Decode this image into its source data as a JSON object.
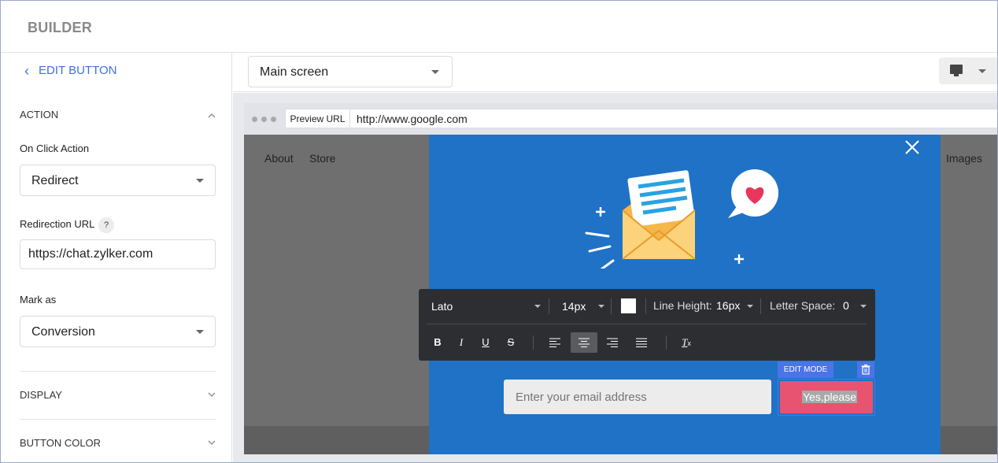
{
  "header": {
    "title": "BUILDER"
  },
  "sidebar": {
    "back_label": "EDIT BUTTON",
    "action_section": "ACTION",
    "on_click_label": "On Click Action",
    "on_click_value": "Redirect",
    "redirection_label": "Redirection URL",
    "help_glyph": "?",
    "redirection_value": "https://chat.zylker.com",
    "mark_as_label": "Mark as",
    "mark_as_value": "Conversion",
    "display_section": "DISPLAY",
    "button_color_section": "BUTTON COLOR"
  },
  "toolbar": {
    "screen_value": "Main screen",
    "device": "desktop-monitor-icon"
  },
  "preview": {
    "preview_tag": "Preview URL",
    "url": "http://www.google.com",
    "links": {
      "about": "About",
      "store": "Store",
      "images": "Images"
    },
    "popup": {
      "email_placeholder": "Enter your email address",
      "edit_mode": "EDIT MODE",
      "cta_label": "Yes,please"
    }
  },
  "format_toolbar": {
    "font": "Lato",
    "size": "14px",
    "line_height_label": "Line Height:",
    "line_height_value": "16px",
    "letter_space_label": "Letter Space:",
    "letter_space_value": "0",
    "bold": "B",
    "italic": "I",
    "underline": "U",
    "strike": "S",
    "clear": "T"
  },
  "colors": {
    "accent": "#3d6ee8",
    "popup_bg": "#1f72c5",
    "cta_bg": "#e85370",
    "format_toolbar_bg": "#2d2e31"
  }
}
